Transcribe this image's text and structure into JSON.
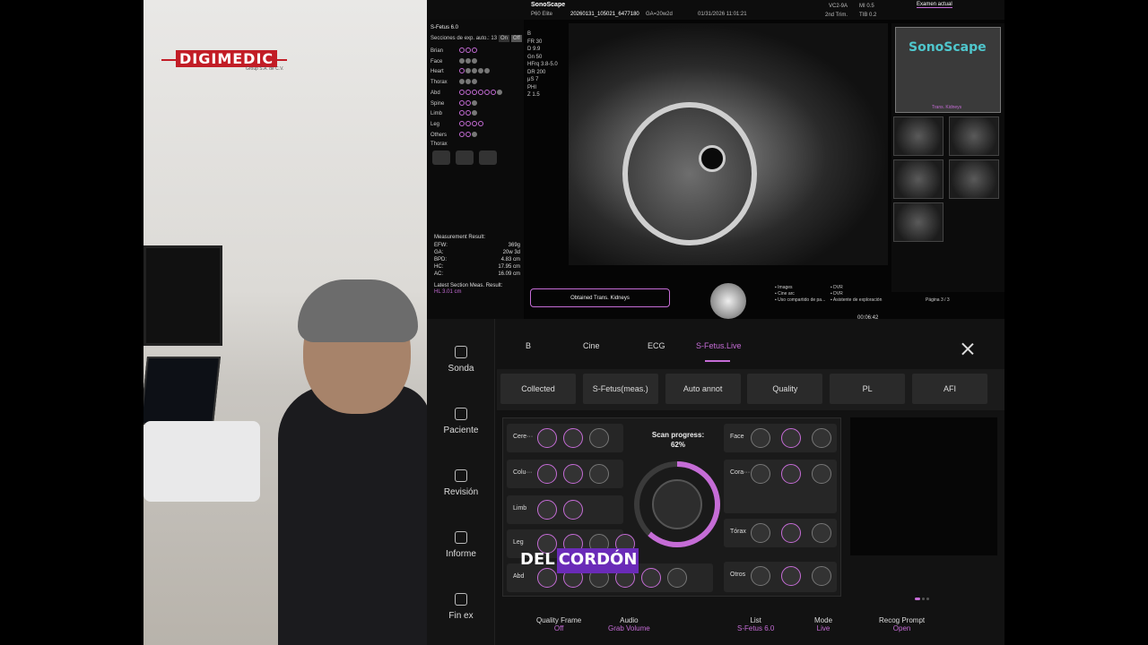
{
  "video": {
    "logo_text": "DIGIMEDIC",
    "logo_sub": "Group S.A. de C.V."
  },
  "screen": {
    "topbar": {
      "brand": "SonoScape",
      "model": "P60 Elite",
      "exam_id": "20260131_105021_6477180",
      "ga": "GA=20w2d",
      "datetime": "01/31/2026 11:01:21",
      "probe": "VC2-9A",
      "trim": "2nd Trim.",
      "mi": "MI 0.5",
      "tib": "TIB 0.2",
      "exam_label": "Examen actual"
    },
    "sfetus": {
      "title": "S-Fetus 6.0",
      "sections_label": "Secciones de exp. auto.: 13",
      "toggle_on": "On",
      "toggle_off": "Off",
      "rows": [
        {
          "label": "Brian",
          "dots": [
            "p",
            "p",
            "p"
          ]
        },
        {
          "label": "Face",
          "dots": [
            "g",
            "g",
            "g"
          ]
        },
        {
          "label": "Heart",
          "dots": [
            "p",
            "g",
            "g",
            "g",
            "g"
          ]
        },
        {
          "label": "Thorax",
          "dots": [
            "g",
            "g",
            "g"
          ]
        },
        {
          "label": "Abd",
          "dots": [
            "p",
            "p",
            "p",
            "p",
            "p",
            "p",
            "g"
          ]
        },
        {
          "label": "Spine",
          "dots": [
            "p",
            "p",
            "g"
          ]
        },
        {
          "label": "Limb",
          "dots": [
            "p",
            "p",
            "g"
          ]
        },
        {
          "label": "Leg",
          "dots": [
            "p",
            "p",
            "p",
            "p"
          ]
        },
        {
          "label": "Others",
          "dots": [
            "p",
            "p",
            "g"
          ]
        }
      ],
      "section_title": "Thorax"
    },
    "params": [
      "B",
      "FR   30",
      "D    9.9",
      "Gn   50",
      "HFrq 3.8-5.0",
      "DR   200",
      "μS   7",
      "PHI",
      "Z    1.5"
    ],
    "thumb_brand": "SonoScape",
    "thumb_caption": "Trans. Kidneys",
    "measurement": {
      "title": "Measurement Result:",
      "rows": [
        {
          "k": "EFW:",
          "v": "369g"
        },
        {
          "k": "GA:",
          "v": "20w 3d"
        },
        {
          "k": "BPD:",
          "v": "4.83  cm"
        },
        {
          "k": "HC:",
          "v": "17.95  cm"
        },
        {
          "k": "AC:",
          "v": "16.09  cm"
        }
      ],
      "latest_title": "Latest Section Meas. Result:",
      "latest_value": "HL  3.01  cm"
    },
    "obtained": "Obtained Trans. Kidneys",
    "legend": [
      "Images",
      "Cine arc",
      "Uso compartido de pa...",
      "DVR",
      "DVR",
      "Asistente de exploración"
    ],
    "page": "Página 3 / 3",
    "clock": "00:06:42"
  },
  "panel": {
    "nav": [
      {
        "name": "probe",
        "label": "Sonda"
      },
      {
        "name": "patient",
        "label": "Paciente"
      },
      {
        "name": "review",
        "label": "Revisión"
      },
      {
        "name": "report",
        "label": "Informe"
      },
      {
        "name": "end-exam",
        "label": "Fin ex"
      }
    ],
    "tabs": [
      "B",
      "Cine",
      "ECG",
      "S-Fetus.Live"
    ],
    "toolbar": [
      "Collected",
      "S-Fetus(meas.)",
      "Auto annot",
      "Quality",
      "PL",
      "AFI"
    ],
    "scan": {
      "progress_label": "Scan progress:",
      "progress_value": "62%",
      "progress_fraction": 0.62,
      "left_groups": [
        "Cere···",
        "Colu···",
        "Limb",
        "Leg",
        "Abd"
      ],
      "right_groups": [
        "Face",
        "Cora···",
        "Tórax",
        "Otros"
      ]
    },
    "bottom": [
      {
        "k": "Quality Frame",
        "v": "Off"
      },
      {
        "k": "Audio",
        "v": "Grab Volume"
      },
      {
        "k": "List",
        "v": "S-Fetus 6.0"
      },
      {
        "k": "Mode",
        "v": "Live"
      },
      {
        "k": "Recog Prompt",
        "v": "Open"
      }
    ]
  },
  "caption": {
    "word1": "DEL",
    "word2": "CORDÓN"
  },
  "colors": {
    "accent": "#c56cd6",
    "brand_red": "#c21d26",
    "brand_teal": "#4fc7cd"
  }
}
